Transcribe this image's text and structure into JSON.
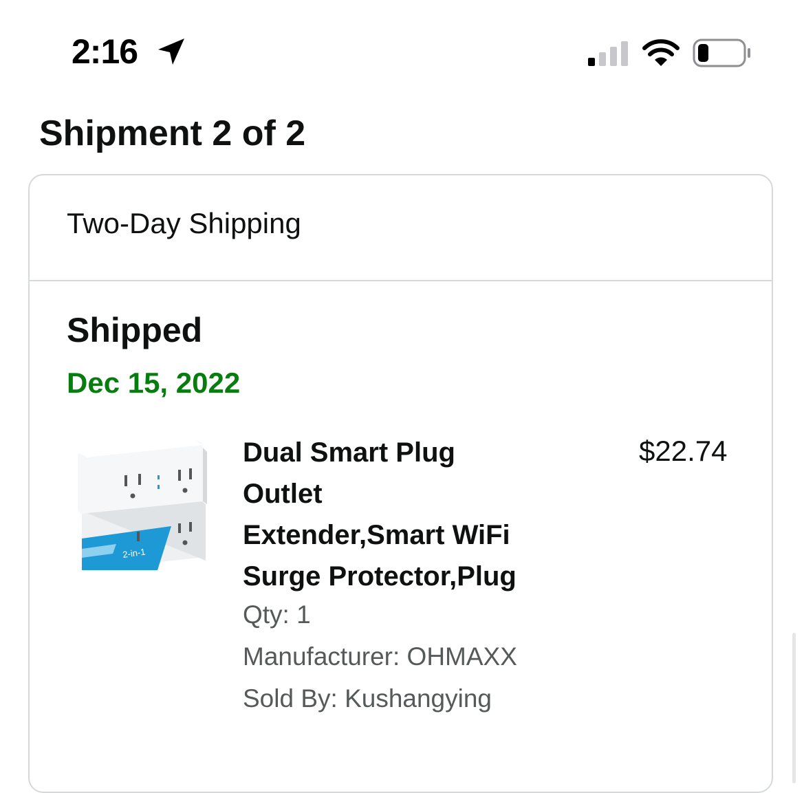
{
  "status_bar": {
    "time": "2:16",
    "icons": [
      "location-arrow-icon",
      "cellular-signal-icon",
      "wifi-icon",
      "battery-icon"
    ],
    "battery_level": 0.2
  },
  "shipment": {
    "title": "Shipment 2 of 2",
    "delivery_speed": "Two-Day Shipping",
    "status": "Shipped",
    "status_date": "Dec 15, 2022",
    "status_date_color": "#067d0e",
    "item": {
      "image_icon": "smart-plug-product-image",
      "image_label": "2-in-1",
      "title_lines": [
        "Dual Smart Plug",
        "Outlet",
        "Extender,Smart WiFi",
        "Surge Protector,Plug"
      ],
      "price": "$22.74",
      "qty": "Qty: 1",
      "manufacturer": "Manufacturer: OHMAXX",
      "sold_by": "Sold By: Kushangying"
    }
  }
}
